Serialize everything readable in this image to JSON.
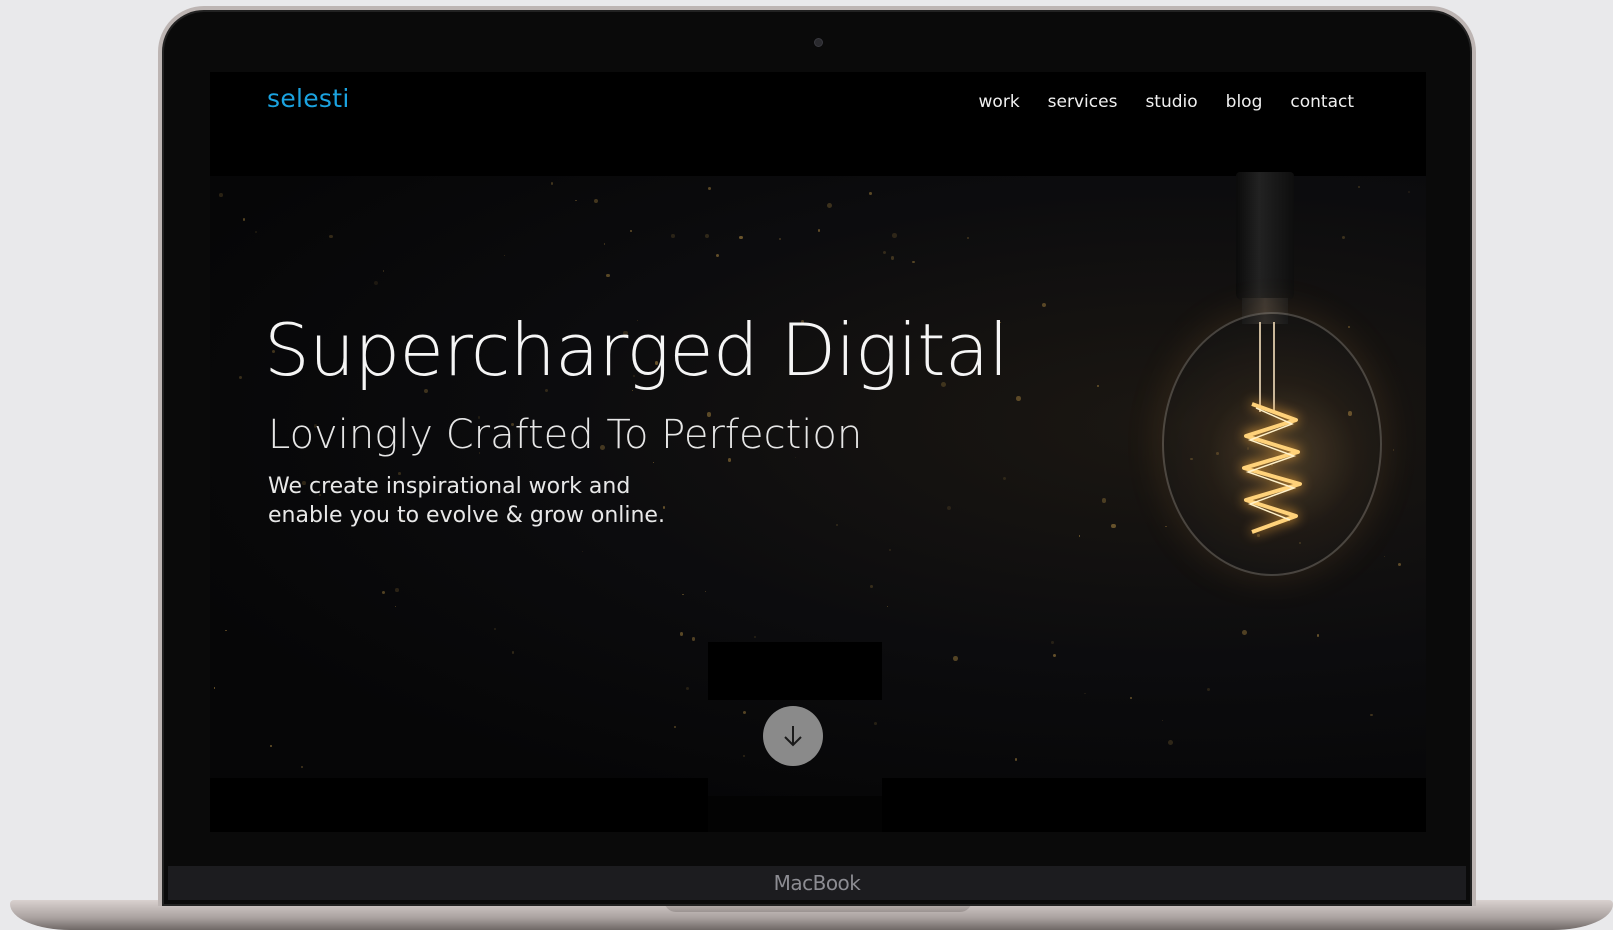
{
  "device": {
    "label": "MacBook"
  },
  "site": {
    "logo": "selesti",
    "colors": {
      "brand": "#1ba3e0",
      "background": "#030303",
      "text": "#f5f5f5",
      "scroll_button": "#8a8a8a"
    },
    "nav": [
      {
        "label": "work"
      },
      {
        "label": "services"
      },
      {
        "label": "studio"
      },
      {
        "label": "blog"
      },
      {
        "label": "contact"
      }
    ]
  },
  "hero": {
    "title": "Supercharged Digital",
    "subtitle": "Lovingly Crafted To Perfection",
    "body": "We create inspirational work and enable you to evolve & grow online.",
    "image": "lightbulb-icon",
    "scroll_icon": "arrow-down-icon"
  }
}
